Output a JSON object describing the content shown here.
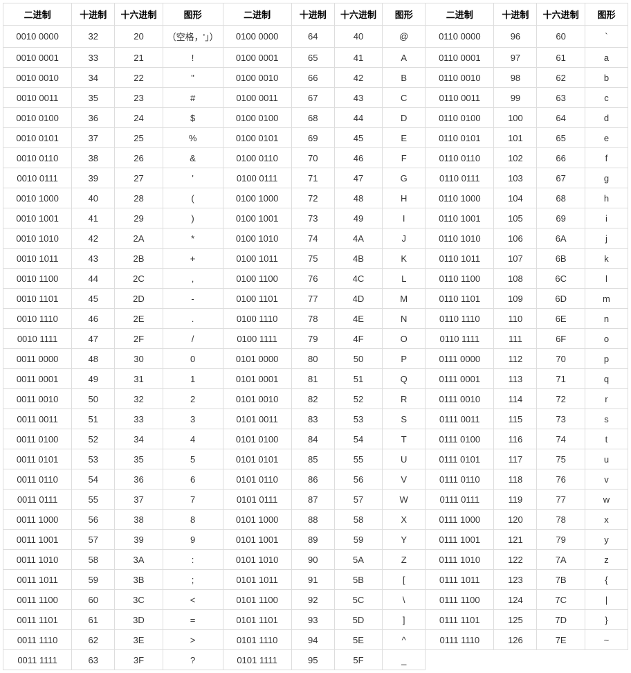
{
  "headers": {
    "bin": "二进制",
    "dec": "十进制",
    "hex": "十六进制",
    "glyph": "图形"
  },
  "chart_data": {
    "type": "table",
    "title": "ASCII Table (printable characters 32-126)",
    "columns": [
      "二进制",
      "十进制",
      "十六进制",
      "图形"
    ],
    "rows": [
      {
        "bin": "0010 0000",
        "dec": "32",
        "hex": "20",
        "glyph": "（空格，'」）"
      },
      {
        "bin": "0010 0001",
        "dec": "33",
        "hex": "21",
        "glyph": "!"
      },
      {
        "bin": "0010 0010",
        "dec": "34",
        "hex": "22",
        "glyph": "\""
      },
      {
        "bin": "0010 0011",
        "dec": "35",
        "hex": "23",
        "glyph": "#"
      },
      {
        "bin": "0010 0100",
        "dec": "36",
        "hex": "24",
        "glyph": "$"
      },
      {
        "bin": "0010 0101",
        "dec": "37",
        "hex": "25",
        "glyph": "%"
      },
      {
        "bin": "0010 0110",
        "dec": "38",
        "hex": "26",
        "glyph": "&"
      },
      {
        "bin": "0010 0111",
        "dec": "39",
        "hex": "27",
        "glyph": "'"
      },
      {
        "bin": "0010 1000",
        "dec": "40",
        "hex": "28",
        "glyph": "("
      },
      {
        "bin": "0010 1001",
        "dec": "41",
        "hex": "29",
        "glyph": ")"
      },
      {
        "bin": "0010 1010",
        "dec": "42",
        "hex": "2A",
        "glyph": "*"
      },
      {
        "bin": "0010 1011",
        "dec": "43",
        "hex": "2B",
        "glyph": "+"
      },
      {
        "bin": "0010 1100",
        "dec": "44",
        "hex": "2C",
        "glyph": ","
      },
      {
        "bin": "0010 1101",
        "dec": "45",
        "hex": "2D",
        "glyph": "-"
      },
      {
        "bin": "0010 1110",
        "dec": "46",
        "hex": "2E",
        "glyph": "."
      },
      {
        "bin": "0010 1111",
        "dec": "47",
        "hex": "2F",
        "glyph": "/"
      },
      {
        "bin": "0011 0000",
        "dec": "48",
        "hex": "30",
        "glyph": "0"
      },
      {
        "bin": "0011 0001",
        "dec": "49",
        "hex": "31",
        "glyph": "1"
      },
      {
        "bin": "0011 0010",
        "dec": "50",
        "hex": "32",
        "glyph": "2"
      },
      {
        "bin": "0011 0011",
        "dec": "51",
        "hex": "33",
        "glyph": "3"
      },
      {
        "bin": "0011 0100",
        "dec": "52",
        "hex": "34",
        "glyph": "4"
      },
      {
        "bin": "0011 0101",
        "dec": "53",
        "hex": "35",
        "glyph": "5"
      },
      {
        "bin": "0011 0110",
        "dec": "54",
        "hex": "36",
        "glyph": "6"
      },
      {
        "bin": "0011 0111",
        "dec": "55",
        "hex": "37",
        "glyph": "7"
      },
      {
        "bin": "0011 1000",
        "dec": "56",
        "hex": "38",
        "glyph": "8"
      },
      {
        "bin": "0011 1001",
        "dec": "57",
        "hex": "39",
        "glyph": "9"
      },
      {
        "bin": "0011 1010",
        "dec": "58",
        "hex": "3A",
        "glyph": ":"
      },
      {
        "bin": "0011 1011",
        "dec": "59",
        "hex": "3B",
        "glyph": ";"
      },
      {
        "bin": "0011 1100",
        "dec": "60",
        "hex": "3C",
        "glyph": "<"
      },
      {
        "bin": "0011 1101",
        "dec": "61",
        "hex": "3D",
        "glyph": "="
      },
      {
        "bin": "0011 1110",
        "dec": "62",
        "hex": "3E",
        "glyph": ">"
      },
      {
        "bin": "0011 1111",
        "dec": "63",
        "hex": "3F",
        "glyph": "?"
      },
      {
        "bin": "0100 0000",
        "dec": "64",
        "hex": "40",
        "glyph": "@"
      },
      {
        "bin": "0100 0001",
        "dec": "65",
        "hex": "41",
        "glyph": "A"
      },
      {
        "bin": "0100 0010",
        "dec": "66",
        "hex": "42",
        "glyph": "B"
      },
      {
        "bin": "0100 0011",
        "dec": "67",
        "hex": "43",
        "glyph": "C"
      },
      {
        "bin": "0100 0100",
        "dec": "68",
        "hex": "44",
        "glyph": "D"
      },
      {
        "bin": "0100 0101",
        "dec": "69",
        "hex": "45",
        "glyph": "E"
      },
      {
        "bin": "0100 0110",
        "dec": "70",
        "hex": "46",
        "glyph": "F"
      },
      {
        "bin": "0100 0111",
        "dec": "71",
        "hex": "47",
        "glyph": "G"
      },
      {
        "bin": "0100 1000",
        "dec": "72",
        "hex": "48",
        "glyph": "H"
      },
      {
        "bin": "0100 1001",
        "dec": "73",
        "hex": "49",
        "glyph": "I"
      },
      {
        "bin": "0100 1010",
        "dec": "74",
        "hex": "4A",
        "glyph": "J"
      },
      {
        "bin": "0100 1011",
        "dec": "75",
        "hex": "4B",
        "glyph": "K"
      },
      {
        "bin": "0100 1100",
        "dec": "76",
        "hex": "4C",
        "glyph": "L"
      },
      {
        "bin": "0100 1101",
        "dec": "77",
        "hex": "4D",
        "glyph": "M"
      },
      {
        "bin": "0100 1110",
        "dec": "78",
        "hex": "4E",
        "glyph": "N"
      },
      {
        "bin": "0100 1111",
        "dec": "79",
        "hex": "4F",
        "glyph": "O"
      },
      {
        "bin": "0101 0000",
        "dec": "80",
        "hex": "50",
        "glyph": "P"
      },
      {
        "bin": "0101 0001",
        "dec": "81",
        "hex": "51",
        "glyph": "Q"
      },
      {
        "bin": "0101 0010",
        "dec": "82",
        "hex": "52",
        "glyph": "R"
      },
      {
        "bin": "0101 0011",
        "dec": "83",
        "hex": "53",
        "glyph": "S"
      },
      {
        "bin": "0101 0100",
        "dec": "84",
        "hex": "54",
        "glyph": "T"
      },
      {
        "bin": "0101 0101",
        "dec": "85",
        "hex": "55",
        "glyph": "U"
      },
      {
        "bin": "0101 0110",
        "dec": "86",
        "hex": "56",
        "glyph": "V"
      },
      {
        "bin": "0101 0111",
        "dec": "87",
        "hex": "57",
        "glyph": "W"
      },
      {
        "bin": "0101 1000",
        "dec": "88",
        "hex": "58",
        "glyph": "X"
      },
      {
        "bin": "0101 1001",
        "dec": "89",
        "hex": "59",
        "glyph": "Y"
      },
      {
        "bin": "0101 1010",
        "dec": "90",
        "hex": "5A",
        "glyph": "Z"
      },
      {
        "bin": "0101 1011",
        "dec": "91",
        "hex": "5B",
        "glyph": "["
      },
      {
        "bin": "0101 1100",
        "dec": "92",
        "hex": "5C",
        "glyph": "\\"
      },
      {
        "bin": "0101 1101",
        "dec": "93",
        "hex": "5D",
        "glyph": "]"
      },
      {
        "bin": "0101 1110",
        "dec": "94",
        "hex": "5E",
        "glyph": "^"
      },
      {
        "bin": "0101 1111",
        "dec": "95",
        "hex": "5F",
        "glyph": "_"
      },
      {
        "bin": "0110 0000",
        "dec": "96",
        "hex": "60",
        "glyph": "`"
      },
      {
        "bin": "0110 0001",
        "dec": "97",
        "hex": "61",
        "glyph": "a"
      },
      {
        "bin": "0110 0010",
        "dec": "98",
        "hex": "62",
        "glyph": "b"
      },
      {
        "bin": "0110 0011",
        "dec": "99",
        "hex": "63",
        "glyph": "c"
      },
      {
        "bin": "0110 0100",
        "dec": "100",
        "hex": "64",
        "glyph": "d"
      },
      {
        "bin": "0110 0101",
        "dec": "101",
        "hex": "65",
        "glyph": "e"
      },
      {
        "bin": "0110 0110",
        "dec": "102",
        "hex": "66",
        "glyph": "f"
      },
      {
        "bin": "0110 0111",
        "dec": "103",
        "hex": "67",
        "glyph": "g"
      },
      {
        "bin": "0110 1000",
        "dec": "104",
        "hex": "68",
        "glyph": "h"
      },
      {
        "bin": "0110 1001",
        "dec": "105",
        "hex": "69",
        "glyph": "i"
      },
      {
        "bin": "0110 1010",
        "dec": "106",
        "hex": "6A",
        "glyph": "j"
      },
      {
        "bin": "0110 1011",
        "dec": "107",
        "hex": "6B",
        "glyph": "k"
      },
      {
        "bin": "0110 1100",
        "dec": "108",
        "hex": "6C",
        "glyph": "l"
      },
      {
        "bin": "0110 1101",
        "dec": "109",
        "hex": "6D",
        "glyph": "m"
      },
      {
        "bin": "0110 1110",
        "dec": "110",
        "hex": "6E",
        "glyph": "n"
      },
      {
        "bin": "0110 1111",
        "dec": "111",
        "hex": "6F",
        "glyph": "o"
      },
      {
        "bin": "0111 0000",
        "dec": "112",
        "hex": "70",
        "glyph": "p"
      },
      {
        "bin": "0111 0001",
        "dec": "113",
        "hex": "71",
        "glyph": "q"
      },
      {
        "bin": "0111 0010",
        "dec": "114",
        "hex": "72",
        "glyph": "r"
      },
      {
        "bin": "0111 0011",
        "dec": "115",
        "hex": "73",
        "glyph": "s"
      },
      {
        "bin": "0111 0100",
        "dec": "116",
        "hex": "74",
        "glyph": "t"
      },
      {
        "bin": "0111 0101",
        "dec": "117",
        "hex": "75",
        "glyph": "u"
      },
      {
        "bin": "0111 0110",
        "dec": "118",
        "hex": "76",
        "glyph": "v"
      },
      {
        "bin": "0111 0111",
        "dec": "119",
        "hex": "77",
        "glyph": "w"
      },
      {
        "bin": "0111 1000",
        "dec": "120",
        "hex": "78",
        "glyph": "x"
      },
      {
        "bin": "0111 1001",
        "dec": "121",
        "hex": "79",
        "glyph": "y"
      },
      {
        "bin": "0111 1010",
        "dec": "122",
        "hex": "7A",
        "glyph": "z"
      },
      {
        "bin": "0111 1011",
        "dec": "123",
        "hex": "7B",
        "glyph": "{"
      },
      {
        "bin": "0111 1100",
        "dec": "124",
        "hex": "7C",
        "glyph": "|"
      },
      {
        "bin": "0111 1101",
        "dec": "125",
        "hex": "7D",
        "glyph": "}"
      },
      {
        "bin": "0111 1110",
        "dec": "126",
        "hex": "7E",
        "glyph": "~"
      }
    ]
  }
}
